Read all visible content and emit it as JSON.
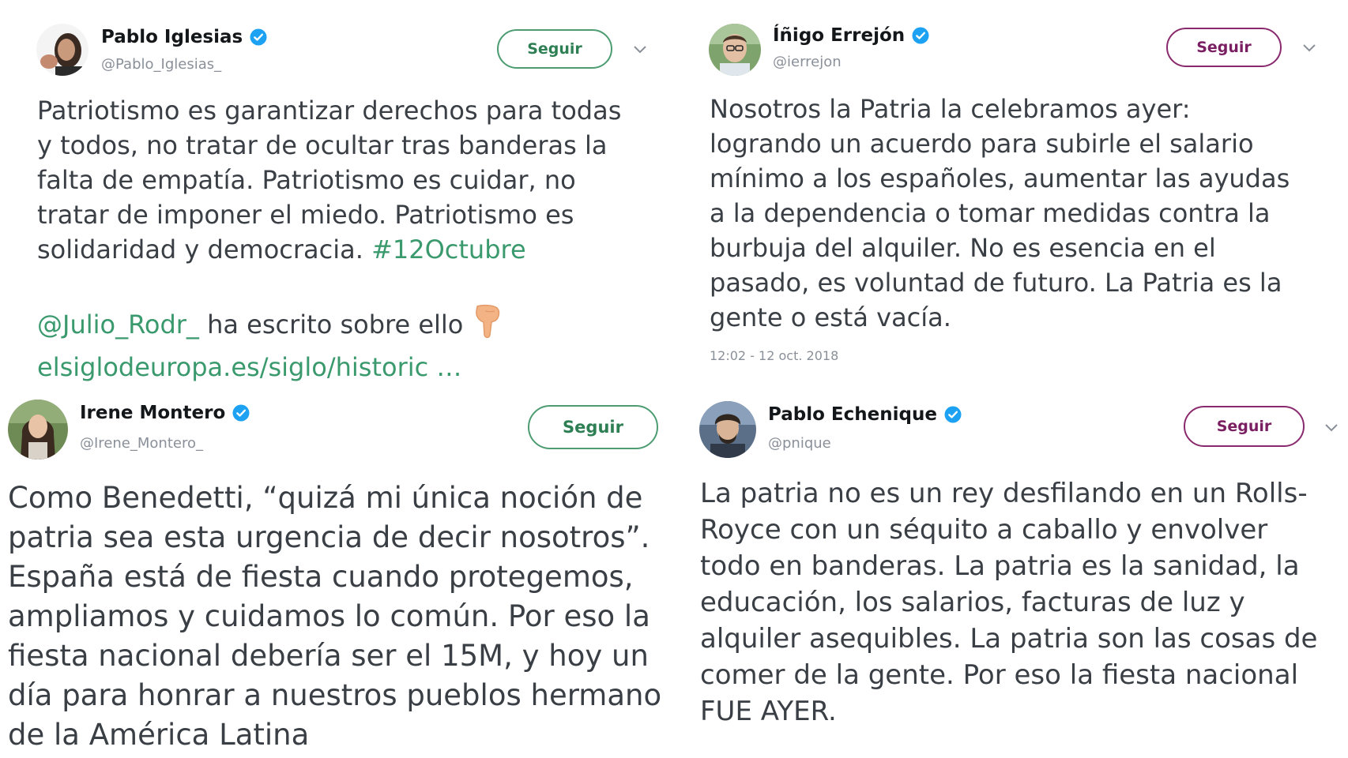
{
  "tweets": [
    {
      "author_name": "Pablo Iglesias",
      "handle": "@Pablo_Iglesias_",
      "follow_label": "Seguir",
      "accent_color": "#4d9c72",
      "text_lines": [
        "Patriotismo es garantizar derechos para todas",
        "y todos, no tratar de ocultar tras banderas la",
        "falta de empatía. Patriotismo es cuidar, no",
        "tratar de imponer el miedo. Patriotismo es",
        "solidaridad y democracia. "
      ],
      "hashtag": "#12Octubre",
      "mention": "@Julio_Rodr_",
      "mention_text": " ha escrito sobre ello",
      "url": "elsiglodeuropa.es/siglo/historic",
      "ellipsis": " …",
      "emoji": "pointing-down-hand-icon"
    },
    {
      "author_name": "Íñigo Errejón",
      "handle": "@ierrejon",
      "follow_label": "Seguir",
      "accent_color": "#8a2a6e",
      "text_lines": [
        "Nosotros la Patria la celebramos ayer:",
        "logrando un acuerdo para subirle el salario",
        "mínimo a los españoles, aumentar las ayudas",
        "a la dependencia o tomar medidas contra la",
        "burbuja del alquiler. No es esencia en el",
        "pasado, es voluntad de futuro. La Patria es la",
        "gente o está vacía."
      ],
      "timestamp": "12:02 - 12 oct. 2018"
    },
    {
      "author_name": "Irene Montero",
      "handle": "@Irene_Montero_",
      "follow_label": "Seguir",
      "accent_color": "#4d9c72",
      "text_lines": [
        "Como Benedetti, “quizá mi única noción de",
        "patria sea esta urgencia de decir nosotros”.",
        "España está de fiesta cuando protegemos,",
        "ampliamos y cuidamos lo común. Por eso la",
        "fiesta nacional debería ser el 15M, y hoy un",
        "día para honrar a nuestros pueblos hermano",
        "de la América Latina"
      ]
    },
    {
      "author_name": "Pablo Echenique",
      "handle": "@pnique",
      "follow_label": "Seguir",
      "accent_color": "#8a2a6e",
      "text_lines": [
        "La patria no es un rey desfilando en un Rolls-",
        "Royce con un séquito a caballo y envolver",
        "todo en banderas. La patria es la sanidad, la",
        "educación, los salarios, facturas de luz y",
        "alquiler asequibles. La patria son las cosas de",
        "comer de la gente. Por eso la fiesta nacional",
        "FUE AYER."
      ]
    }
  ],
  "colors": {
    "verified_badge": "#1da1f2",
    "link": "#3a9a6e",
    "body_text": "#3a3f45",
    "meta_text": "#8a9099"
  }
}
